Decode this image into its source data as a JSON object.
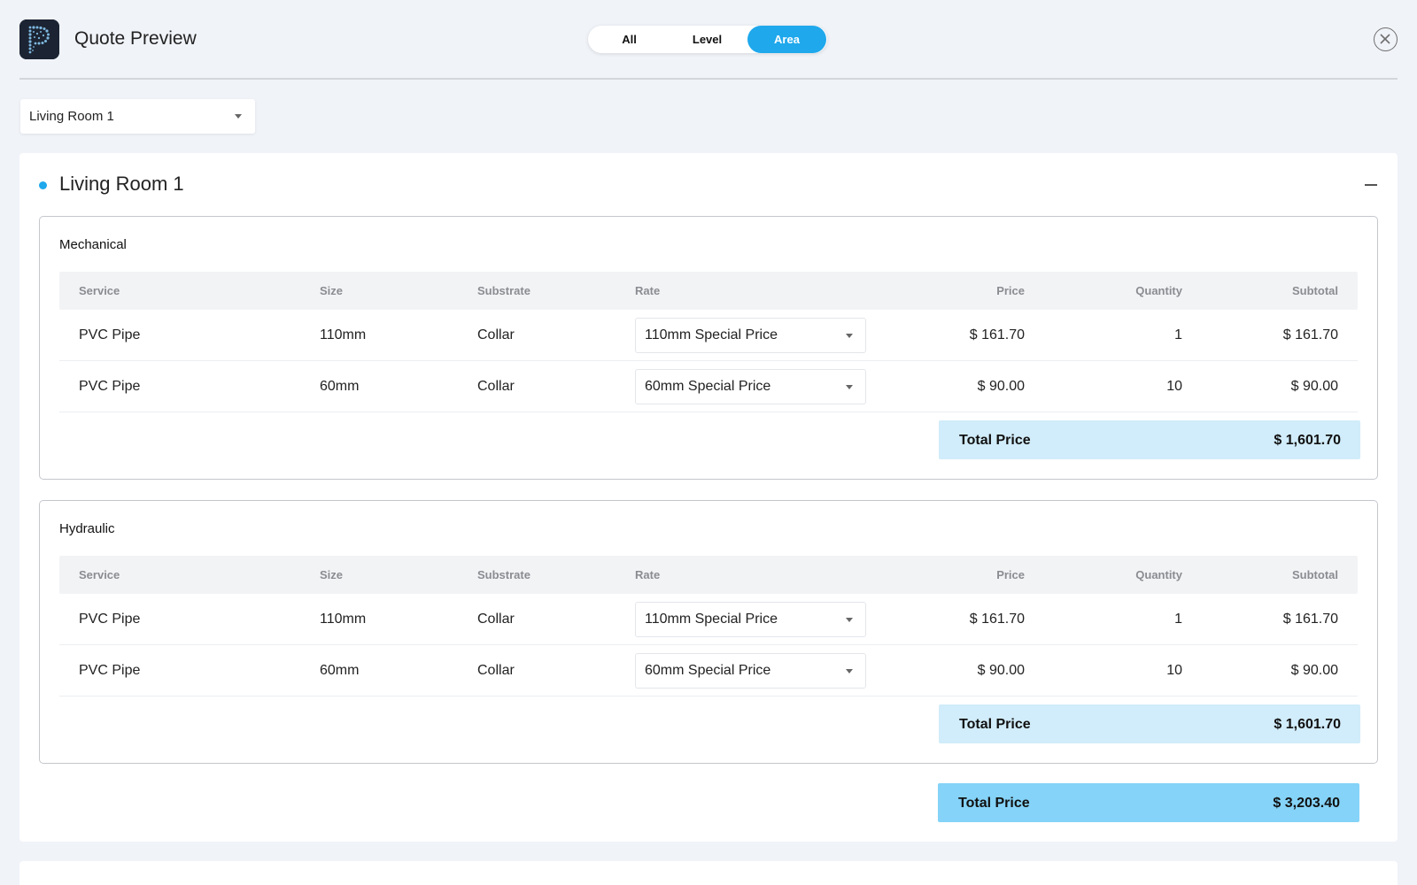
{
  "header": {
    "title": "Quote Preview",
    "tabs": [
      {
        "label": "All",
        "active": false
      },
      {
        "label": "Level",
        "active": false
      },
      {
        "label": "Area",
        "active": true
      }
    ],
    "close_icon": "close-icon"
  },
  "area_selector": {
    "value": "Living Room 1"
  },
  "area": {
    "title": "Living Room 1",
    "sections": [
      {
        "title": "Mechanical",
        "columns": [
          "Service",
          "Size",
          "Substrate",
          "Rate",
          "Price",
          "Quantity",
          "Subtotal"
        ],
        "rows": [
          {
            "service": "PVC Pipe",
            "size": "110mm",
            "substrate": "Collar",
            "rate": "110mm Special Price",
            "price": "$ 161.70",
            "quantity": "1",
            "subtotal": "$ 161.70"
          },
          {
            "service": "PVC Pipe",
            "size": "60mm",
            "substrate": "Collar",
            "rate": "60mm Special Price",
            "price": "$ 90.00",
            "quantity": "10",
            "subtotal": "$ 90.00"
          }
        ],
        "total_label": "Total Price",
        "total_value": "$ 1,601.70"
      },
      {
        "title": "Hydraulic",
        "columns": [
          "Service",
          "Size",
          "Substrate",
          "Rate",
          "Price",
          "Quantity",
          "Subtotal"
        ],
        "rows": [
          {
            "service": "PVC Pipe",
            "size": "110mm",
            "substrate": "Collar",
            "rate": "110mm Special Price",
            "price": "$ 161.70",
            "quantity": "1",
            "subtotal": "$ 161.70"
          },
          {
            "service": "PVC Pipe",
            "size": "60mm",
            "substrate": "Collar",
            "rate": "60mm Special Price",
            "price": "$ 90.00",
            "quantity": "10",
            "subtotal": "$ 90.00"
          }
        ],
        "total_label": "Total Price",
        "total_value": "$ 1,601.70"
      }
    ],
    "grand_total_label": "Total Price",
    "grand_total_value": "$ 3,203.40"
  },
  "colors": {
    "accent": "#1fa8ec",
    "section_total_bg": "#d1ecfa",
    "grand_total_bg": "#85d3f8",
    "page_bg": "#f0f3f8"
  }
}
